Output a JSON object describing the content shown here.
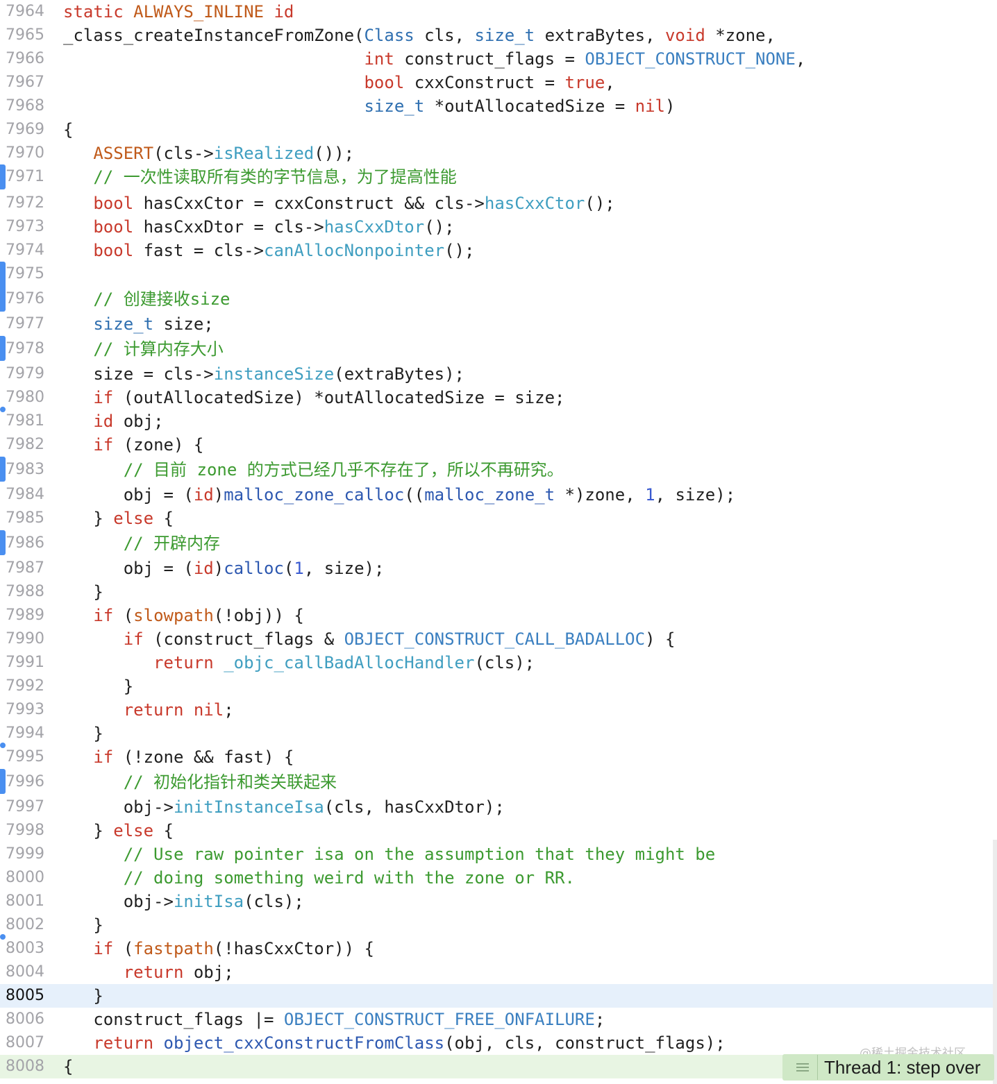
{
  "editor": {
    "lines": [
      {
        "number": "7964",
        "tokens": [
          {
            "t": "static ",
            "c": "kw"
          },
          {
            "t": "ALWAYS_INLINE",
            "c": "macro"
          },
          {
            "t": " ",
            "c": "plain"
          },
          {
            "t": "id",
            "c": "kw"
          }
        ]
      },
      {
        "number": "7965",
        "tokens": [
          {
            "t": "_class_createInstanceFromZone(",
            "c": "plain"
          },
          {
            "t": "Class",
            "c": "type"
          },
          {
            "t": " cls, ",
            "c": "plain"
          },
          {
            "t": "size_t",
            "c": "type"
          },
          {
            "t": " extraBytes, ",
            "c": "plain"
          },
          {
            "t": "void",
            "c": "kw"
          },
          {
            "t": " *zone,",
            "c": "plain"
          }
        ]
      },
      {
        "number": "7966",
        "tokens": [
          {
            "t": "                              ",
            "c": "plain"
          },
          {
            "t": "int",
            "c": "kw"
          },
          {
            "t": " construct_flags = ",
            "c": "plain"
          },
          {
            "t": "OBJECT_CONSTRUCT_NONE",
            "c": "const"
          },
          {
            "t": ",",
            "c": "plain"
          }
        ]
      },
      {
        "number": "7967",
        "tokens": [
          {
            "t": "                              ",
            "c": "plain"
          },
          {
            "t": "bool",
            "c": "kw"
          },
          {
            "t": " cxxConstruct = ",
            "c": "plain"
          },
          {
            "t": "true",
            "c": "kw"
          },
          {
            "t": ",",
            "c": "plain"
          }
        ]
      },
      {
        "number": "7968",
        "tokens": [
          {
            "t": "                              ",
            "c": "plain"
          },
          {
            "t": "size_t",
            "c": "type"
          },
          {
            "t": " *outAllocatedSize = ",
            "c": "plain"
          },
          {
            "t": "nil",
            "c": "kw"
          },
          {
            "t": ")",
            "c": "plain"
          }
        ]
      },
      {
        "number": "7969",
        "tokens": [
          {
            "t": "{",
            "c": "plain"
          }
        ]
      },
      {
        "number": "7970",
        "tokens": [
          {
            "t": "   ",
            "c": "plain"
          },
          {
            "t": "ASSERT",
            "c": "macro"
          },
          {
            "t": "(cls->",
            "c": "plain"
          },
          {
            "t": "isRealized",
            "c": "func"
          },
          {
            "t": "());",
            "c": "plain"
          }
        ]
      },
      {
        "number": "7971",
        "tokens": [
          {
            "t": "   ",
            "c": "plain"
          },
          {
            "t": "// 一次性读取所有类的字节信息，为了提高性能",
            "c": "cmt"
          }
        ]
      },
      {
        "number": "7972",
        "tokens": [
          {
            "t": "   ",
            "c": "plain"
          },
          {
            "t": "bool",
            "c": "kw"
          },
          {
            "t": " hasCxxCtor = cxxConstruct && cls->",
            "c": "plain"
          },
          {
            "t": "hasCxxCtor",
            "c": "func"
          },
          {
            "t": "();",
            "c": "plain"
          }
        ]
      },
      {
        "number": "7973",
        "tokens": [
          {
            "t": "   ",
            "c": "plain"
          },
          {
            "t": "bool",
            "c": "kw"
          },
          {
            "t": " hasCxxDtor = cls->",
            "c": "plain"
          },
          {
            "t": "hasCxxDtor",
            "c": "func"
          },
          {
            "t": "();",
            "c": "plain"
          }
        ]
      },
      {
        "number": "7974",
        "tokens": [
          {
            "t": "   ",
            "c": "plain"
          },
          {
            "t": "bool",
            "c": "kw"
          },
          {
            "t": " fast = cls->",
            "c": "plain"
          },
          {
            "t": "canAllocNonpointer",
            "c": "func"
          },
          {
            "t": "();",
            "c": "plain"
          }
        ]
      },
      {
        "number": "7975",
        "tokens": []
      },
      {
        "number": "7976",
        "tokens": [
          {
            "t": "   ",
            "c": "plain"
          },
          {
            "t": "// 创建接收size",
            "c": "cmt"
          }
        ]
      },
      {
        "number": "7977",
        "tokens": [
          {
            "t": "   ",
            "c": "plain"
          },
          {
            "t": "size_t",
            "c": "type"
          },
          {
            "t": " size;",
            "c": "plain"
          }
        ]
      },
      {
        "number": "7978",
        "tokens": [
          {
            "t": "   ",
            "c": "plain"
          },
          {
            "t": "// 计算内存大小",
            "c": "cmt"
          }
        ]
      },
      {
        "number": "7979",
        "tokens": [
          {
            "t": "   ",
            "c": "plain"
          },
          {
            "t": "size = cls->",
            "c": "plain"
          },
          {
            "t": "instanceSize",
            "c": "func"
          },
          {
            "t": "(extraBytes);",
            "c": "plain"
          }
        ]
      },
      {
        "number": "7980",
        "tokens": [
          {
            "t": "   ",
            "c": "plain"
          },
          {
            "t": "if",
            "c": "kw"
          },
          {
            "t": " (outAllocatedSize) *outAllocatedSize = size;",
            "c": "plain"
          }
        ]
      },
      {
        "number": "7981",
        "tokens": [
          {
            "t": "   ",
            "c": "plain"
          },
          {
            "t": "id",
            "c": "kw"
          },
          {
            "t": " obj;",
            "c": "plain"
          }
        ]
      },
      {
        "number": "7982",
        "tokens": [
          {
            "t": "   ",
            "c": "plain"
          },
          {
            "t": "if",
            "c": "kw"
          },
          {
            "t": " (zone) {",
            "c": "plain"
          }
        ]
      },
      {
        "number": "7983",
        "tokens": [
          {
            "t": "      ",
            "c": "plain"
          },
          {
            "t": "// 目前 zone 的方式已经几乎不存在了，所以不再研究。",
            "c": "cmt"
          }
        ]
      },
      {
        "number": "7984",
        "tokens": [
          {
            "t": "      ",
            "c": "plain"
          },
          {
            "t": "obj = (",
            "c": "plain"
          },
          {
            "t": "id",
            "c": "kw"
          },
          {
            "t": ")",
            "c": "plain"
          },
          {
            "t": "malloc_zone_calloc",
            "c": "func2"
          },
          {
            "t": "((",
            "c": "plain"
          },
          {
            "t": "malloc_zone_t",
            "c": "func2"
          },
          {
            "t": " *)zone, ",
            "c": "plain"
          },
          {
            "t": "1",
            "c": "num"
          },
          {
            "t": ", size);",
            "c": "plain"
          }
        ]
      },
      {
        "number": "7985",
        "tokens": [
          {
            "t": "   ",
            "c": "plain"
          },
          {
            "t": "} ",
            "c": "plain"
          },
          {
            "t": "else",
            "c": "kw"
          },
          {
            "t": " {",
            "c": "plain"
          }
        ]
      },
      {
        "number": "7986",
        "tokens": [
          {
            "t": "      ",
            "c": "plain"
          },
          {
            "t": "// 开辟内存",
            "c": "cmt"
          }
        ]
      },
      {
        "number": "7987",
        "tokens": [
          {
            "t": "      ",
            "c": "plain"
          },
          {
            "t": "obj = (",
            "c": "plain"
          },
          {
            "t": "id",
            "c": "kw"
          },
          {
            "t": ")",
            "c": "plain"
          },
          {
            "t": "calloc",
            "c": "func2"
          },
          {
            "t": "(",
            "c": "plain"
          },
          {
            "t": "1",
            "c": "num"
          },
          {
            "t": ", size);",
            "c": "plain"
          }
        ]
      },
      {
        "number": "7988",
        "tokens": [
          {
            "t": "   ",
            "c": "plain"
          },
          {
            "t": "}",
            "c": "plain"
          }
        ]
      },
      {
        "number": "7989",
        "tokens": [
          {
            "t": "   ",
            "c": "plain"
          },
          {
            "t": "if",
            "c": "kw"
          },
          {
            "t": " (",
            "c": "plain"
          },
          {
            "t": "slowpath",
            "c": "macro"
          },
          {
            "t": "(!obj)) {",
            "c": "plain"
          }
        ]
      },
      {
        "number": "7990",
        "tokens": [
          {
            "t": "      ",
            "c": "plain"
          },
          {
            "t": "if",
            "c": "kw"
          },
          {
            "t": " (construct_flags & ",
            "c": "plain"
          },
          {
            "t": "OBJECT_CONSTRUCT_CALL_BADALLOC",
            "c": "const"
          },
          {
            "t": ") {",
            "c": "plain"
          }
        ]
      },
      {
        "number": "7991",
        "tokens": [
          {
            "t": "         ",
            "c": "plain"
          },
          {
            "t": "return",
            "c": "kw"
          },
          {
            "t": " ",
            "c": "plain"
          },
          {
            "t": "_objc_callBadAllocHandler",
            "c": "func"
          },
          {
            "t": "(cls);",
            "c": "plain"
          }
        ]
      },
      {
        "number": "7992",
        "tokens": [
          {
            "t": "      ",
            "c": "plain"
          },
          {
            "t": "}",
            "c": "plain"
          }
        ]
      },
      {
        "number": "7993",
        "tokens": [
          {
            "t": "      ",
            "c": "plain"
          },
          {
            "t": "return",
            "c": "kw"
          },
          {
            "t": " ",
            "c": "plain"
          },
          {
            "t": "nil",
            "c": "kw"
          },
          {
            "t": ";",
            "c": "plain"
          }
        ]
      },
      {
        "number": "7994",
        "tokens": [
          {
            "t": "   ",
            "c": "plain"
          },
          {
            "t": "}",
            "c": "plain"
          }
        ]
      },
      {
        "number": "7995",
        "tokens": [
          {
            "t": "   ",
            "c": "plain"
          },
          {
            "t": "if",
            "c": "kw"
          },
          {
            "t": " (!zone && fast) {",
            "c": "plain"
          }
        ]
      },
      {
        "number": "7996",
        "tokens": [
          {
            "t": "      ",
            "c": "plain"
          },
          {
            "t": "// 初始化指针和类关联起来",
            "c": "cmt"
          }
        ]
      },
      {
        "number": "7997",
        "tokens": [
          {
            "t": "      ",
            "c": "plain"
          },
          {
            "t": "obj->",
            "c": "plain"
          },
          {
            "t": "initInstanceIsa",
            "c": "func"
          },
          {
            "t": "(cls, hasCxxDtor);",
            "c": "plain"
          }
        ]
      },
      {
        "number": "7998",
        "tokens": [
          {
            "t": "   ",
            "c": "plain"
          },
          {
            "t": "} ",
            "c": "plain"
          },
          {
            "t": "else",
            "c": "kw"
          },
          {
            "t": " {",
            "c": "plain"
          }
        ]
      },
      {
        "number": "7999",
        "tokens": [
          {
            "t": "      ",
            "c": "plain"
          },
          {
            "t": "// Use raw pointer isa on the assumption that they might be",
            "c": "cmt"
          }
        ]
      },
      {
        "number": "8000",
        "tokens": [
          {
            "t": "      ",
            "c": "plain"
          },
          {
            "t": "// doing something weird with the zone or RR.",
            "c": "cmt"
          }
        ]
      },
      {
        "number": "8001",
        "tokens": [
          {
            "t": "      ",
            "c": "plain"
          },
          {
            "t": "obj->",
            "c": "plain"
          },
          {
            "t": "initIsa",
            "c": "func"
          },
          {
            "t": "(cls);",
            "c": "plain"
          }
        ]
      },
      {
        "number": "8002",
        "tokens": [
          {
            "t": "   ",
            "c": "plain"
          },
          {
            "t": "}",
            "c": "plain"
          }
        ]
      },
      {
        "number": "8003",
        "tokens": [
          {
            "t": "   ",
            "c": "plain"
          },
          {
            "t": "if",
            "c": "kw"
          },
          {
            "t": " (",
            "c": "plain"
          },
          {
            "t": "fastpath",
            "c": "macro"
          },
          {
            "t": "(!hasCxxCtor)) {",
            "c": "plain"
          }
        ]
      },
      {
        "number": "8004",
        "tokens": [
          {
            "t": "      ",
            "c": "plain"
          },
          {
            "t": "return",
            "c": "kw"
          },
          {
            "t": " obj;",
            "c": "plain"
          }
        ]
      },
      {
        "number": "8005",
        "tokens": [
          {
            "t": "   ",
            "c": "plain"
          },
          {
            "t": "}",
            "c": "plain"
          }
        ],
        "highlight": "current"
      },
      {
        "number": "8006",
        "tokens": [
          {
            "t": "   ",
            "c": "plain"
          },
          {
            "t": "construct_flags |= ",
            "c": "plain"
          },
          {
            "t": "OBJECT_CONSTRUCT_FREE_ONFAILURE",
            "c": "const"
          },
          {
            "t": ";",
            "c": "plain"
          }
        ]
      },
      {
        "number": "8007",
        "tokens": [
          {
            "t": "   ",
            "c": "plain"
          },
          {
            "t": "return",
            "c": "kw"
          },
          {
            "t": " ",
            "c": "plain"
          },
          {
            "t": "object_cxxConstructFromClass",
            "c": "func2"
          },
          {
            "t": "(obj, cls, construct_flags);",
            "c": "plain"
          }
        ]
      },
      {
        "number": "8008",
        "tokens": [
          {
            "t": "{",
            "c": "plain"
          }
        ],
        "highlight": "debug"
      }
    ]
  },
  "debug_status": {
    "label": "Thread 1: step over",
    "icon": "hamburger-menu-icon"
  },
  "watermark": "@稀土掘金技术社区",
  "colors": {
    "keyword": "#c8392b",
    "type": "#2f6fb0",
    "macro": "#c05a1a",
    "function": "#3f9ec0",
    "comment": "#3c9a30",
    "constant": "#3a7fc0",
    "change_bar": "#4a8ff0",
    "current_line": "#e6f0fb",
    "debug_line": "#e8f5e3"
  }
}
